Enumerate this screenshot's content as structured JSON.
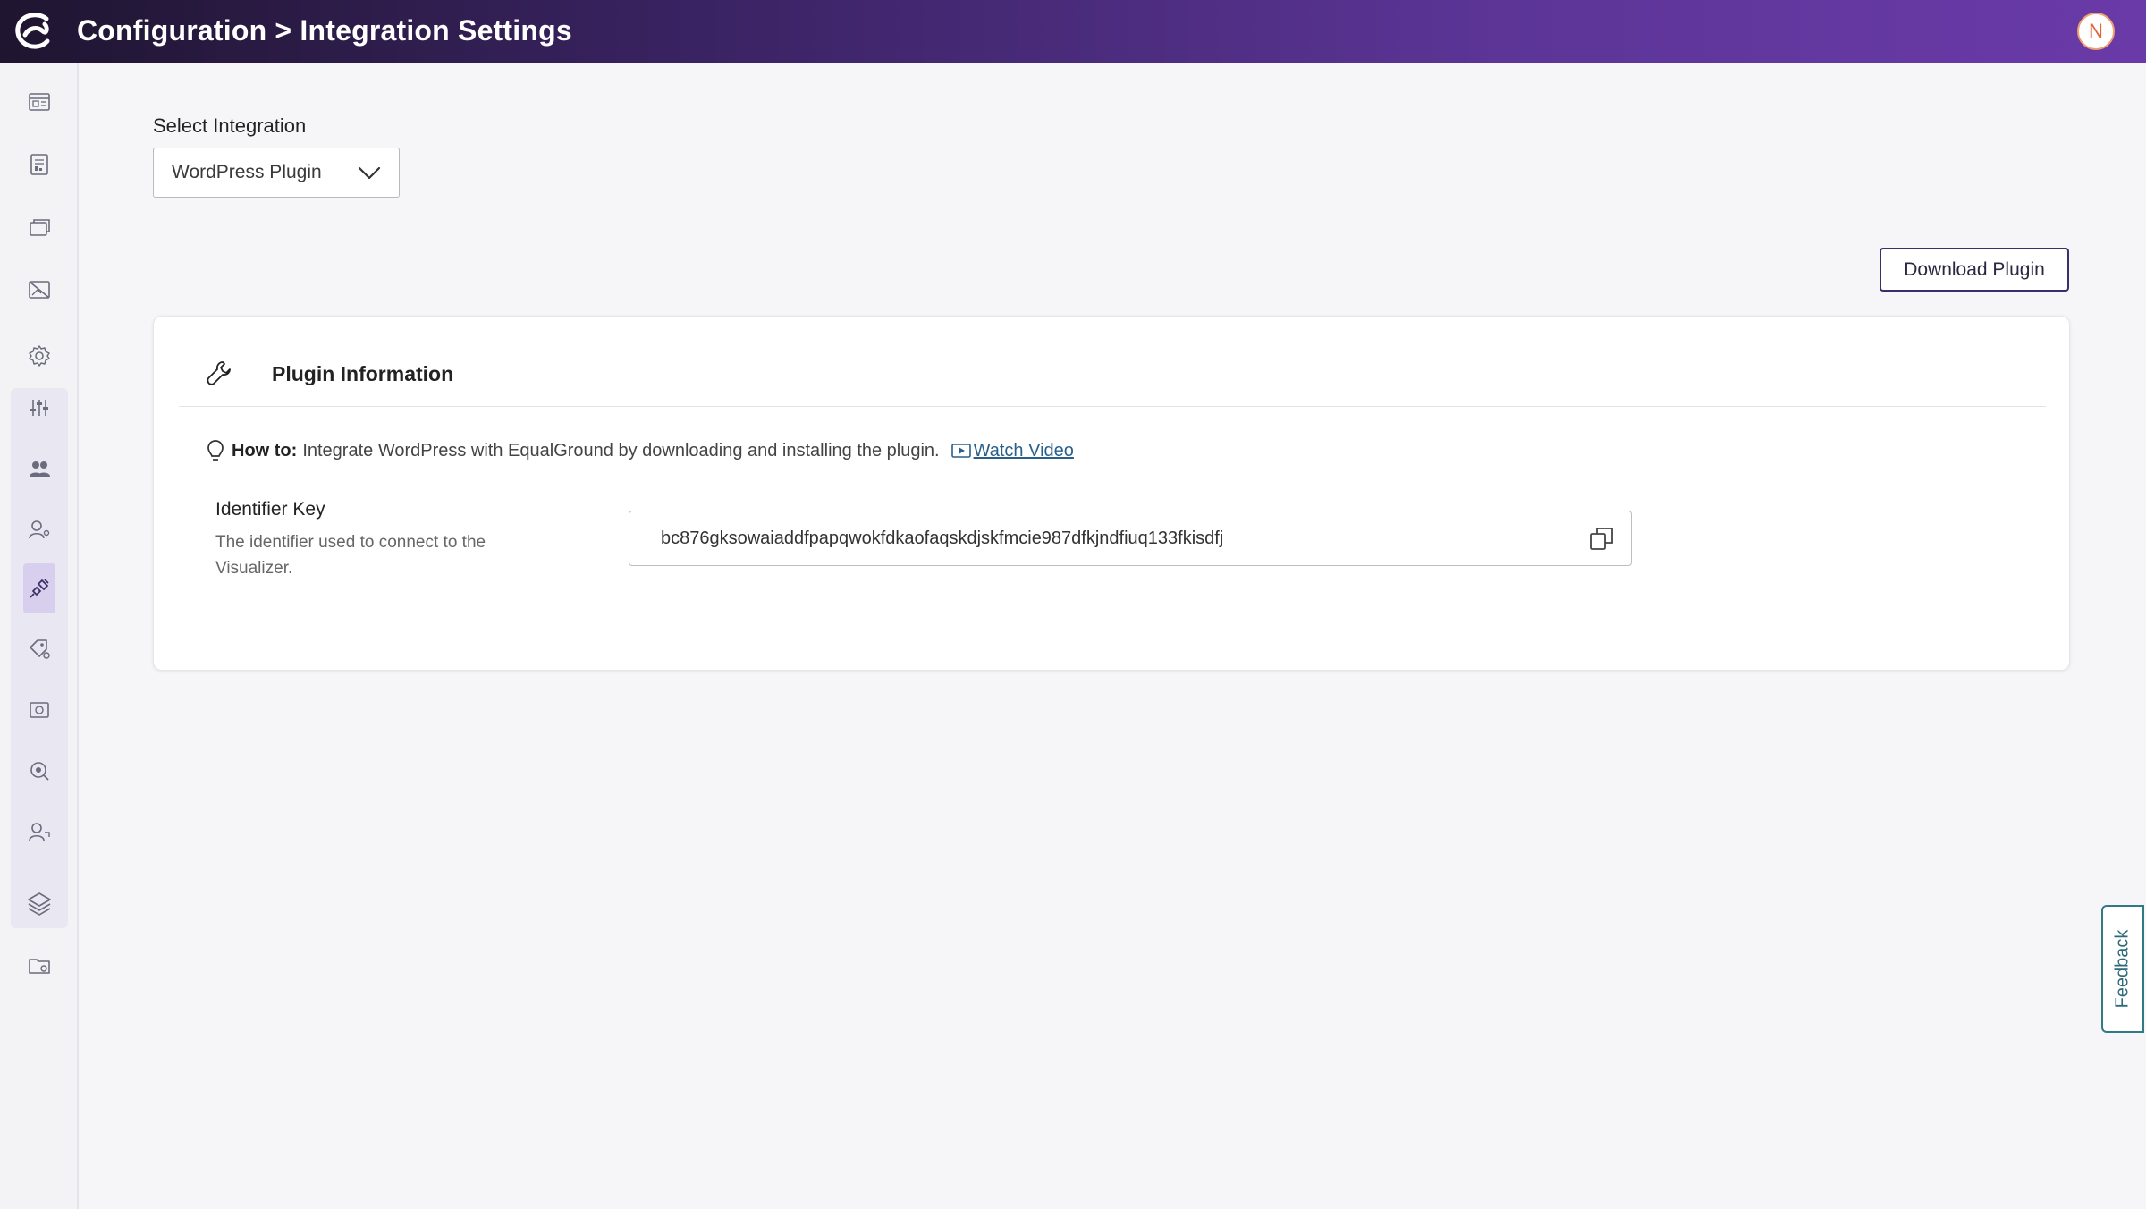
{
  "header": {
    "title": "Configuration > Integration Settings",
    "avatar_initial": "N"
  },
  "sidebar": {
    "items": [
      {
        "icon": "dashboard-icon"
      },
      {
        "icon": "report-icon"
      },
      {
        "icon": "windows-icon"
      },
      {
        "icon": "image-off-icon"
      },
      {
        "icon": "gear-icon"
      },
      {
        "icon": "sliders-icon"
      },
      {
        "icon": "users-icon"
      },
      {
        "icon": "user-settings-icon"
      },
      {
        "icon": "plug-icon",
        "active": true
      },
      {
        "icon": "tag-icon"
      },
      {
        "icon": "photo-frame-icon"
      },
      {
        "icon": "search-circle-icon"
      },
      {
        "icon": "user-key-icon"
      },
      {
        "icon": "layers-icon"
      },
      {
        "icon": "folder-gear-icon"
      }
    ]
  },
  "integration": {
    "label": "Select Integration",
    "selected": "WordPress Plugin"
  },
  "actions": {
    "download_label": "Download Plugin"
  },
  "card": {
    "title": "Plugin Information",
    "howto_prefix": "How to:",
    "howto_text": "Integrate WordPress with EqualGround by downloading and installing the plugin.",
    "watch_video": "Watch Video",
    "identifier_title": "Identifier Key",
    "identifier_desc": "The identifier used to connect to the Visualizer.",
    "identifier_value": "bc876gksowaiaddfpapqwokfdkaofaqskdjskfmcie987dfkjndfiuq133fkisdfj"
  },
  "feedback_label": "Feedback",
  "colors": {
    "header_gradient_start": "#1f1530",
    "header_gradient_end": "#6a3aa8",
    "accent": "#3c2d6e",
    "link": "#2a5f8a",
    "feedback": "#2f7a85"
  }
}
